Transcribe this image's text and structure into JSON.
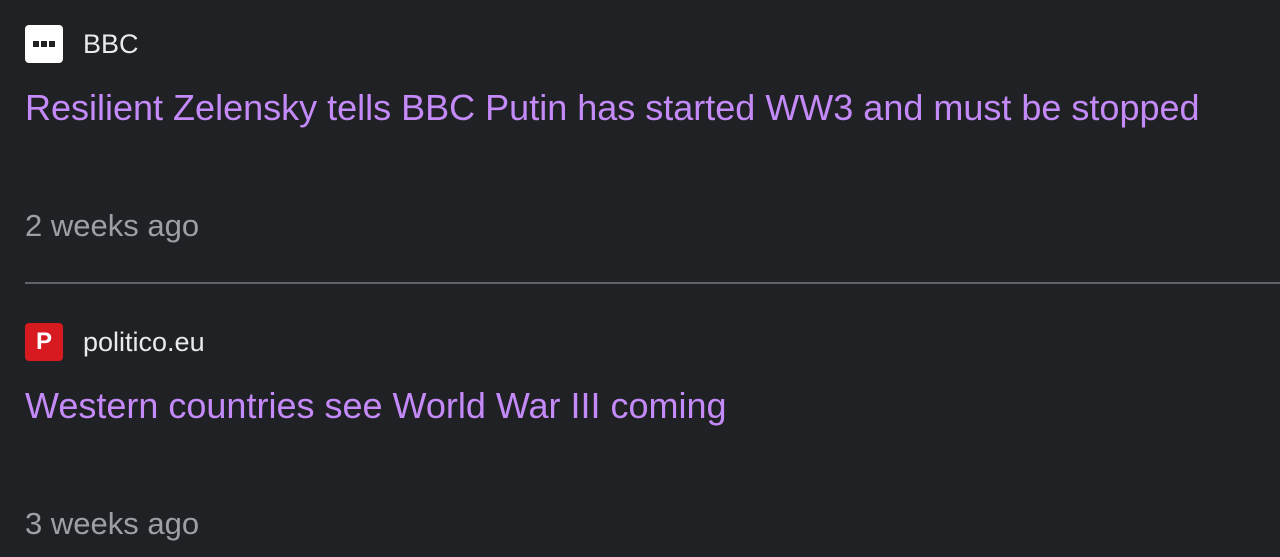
{
  "articles": [
    {
      "source": "BBC",
      "favicon_icon": "bbc-logo-icon",
      "headline": "Resilient Zelensky tells BBC Putin has started WW3 and must be stopped",
      "time": "2 weeks ago"
    },
    {
      "source": "politico.eu",
      "favicon_icon": "politico-logo-icon",
      "favicon_letter": "P",
      "headline": "Western countries see World War III coming",
      "time": "3 weeks ago"
    }
  ],
  "colors": {
    "background": "#202124",
    "headline": "#c58af9",
    "source": "#e8eaed",
    "timestamp": "#9aa0a6",
    "divider": "#5f6368",
    "politico_red": "#d71920"
  }
}
